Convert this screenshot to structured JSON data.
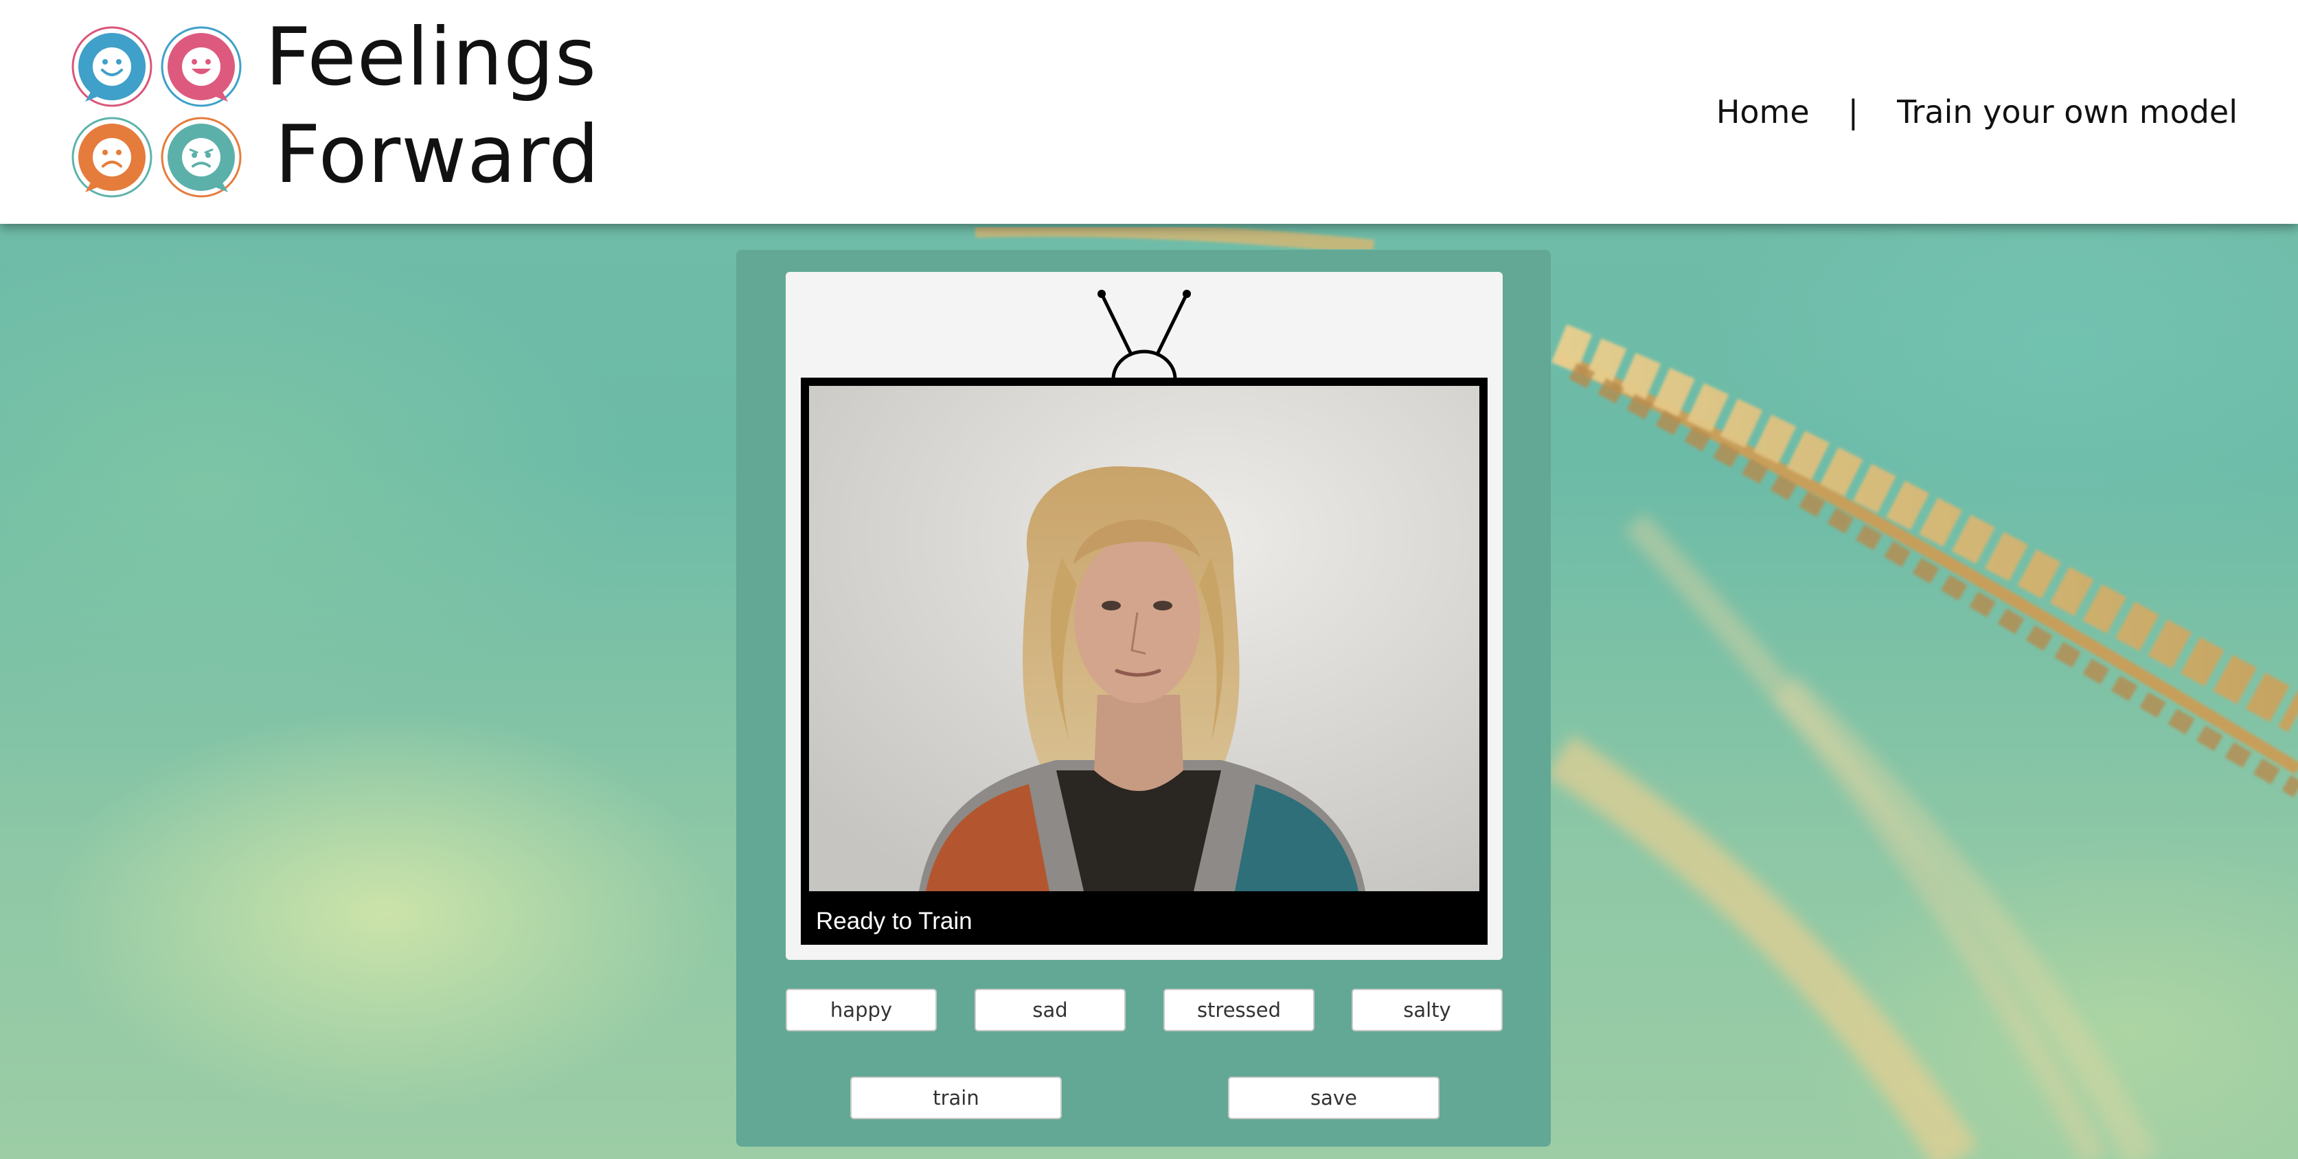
{
  "header": {
    "logo_line1": "Feelings",
    "logo_line2": "Forward",
    "logo_faces": [
      {
        "name": "happy-face-icon",
        "color": "#3fa0c9",
        "ring": "#d9567a"
      },
      {
        "name": "grin-face-icon",
        "color": "#dd5a7e",
        "ring": "#3fa0c9"
      },
      {
        "name": "sad-face-icon",
        "color": "#e57c3c",
        "ring": "#5eb3ab"
      },
      {
        "name": "worried-face-icon",
        "color": "#5cb0aa",
        "ring": "#e57c3c"
      }
    ]
  },
  "nav": {
    "home": "Home",
    "separator": "|",
    "train": "Train your own model"
  },
  "camera": {
    "status": "Ready to Train"
  },
  "emotions": [
    "happy",
    "sad",
    "stressed",
    "salty"
  ],
  "actions": {
    "train": "train",
    "save": "save"
  },
  "colors": {
    "panel": "#62a894",
    "tv_body": "#f4f4f4",
    "screen": "#000000"
  }
}
